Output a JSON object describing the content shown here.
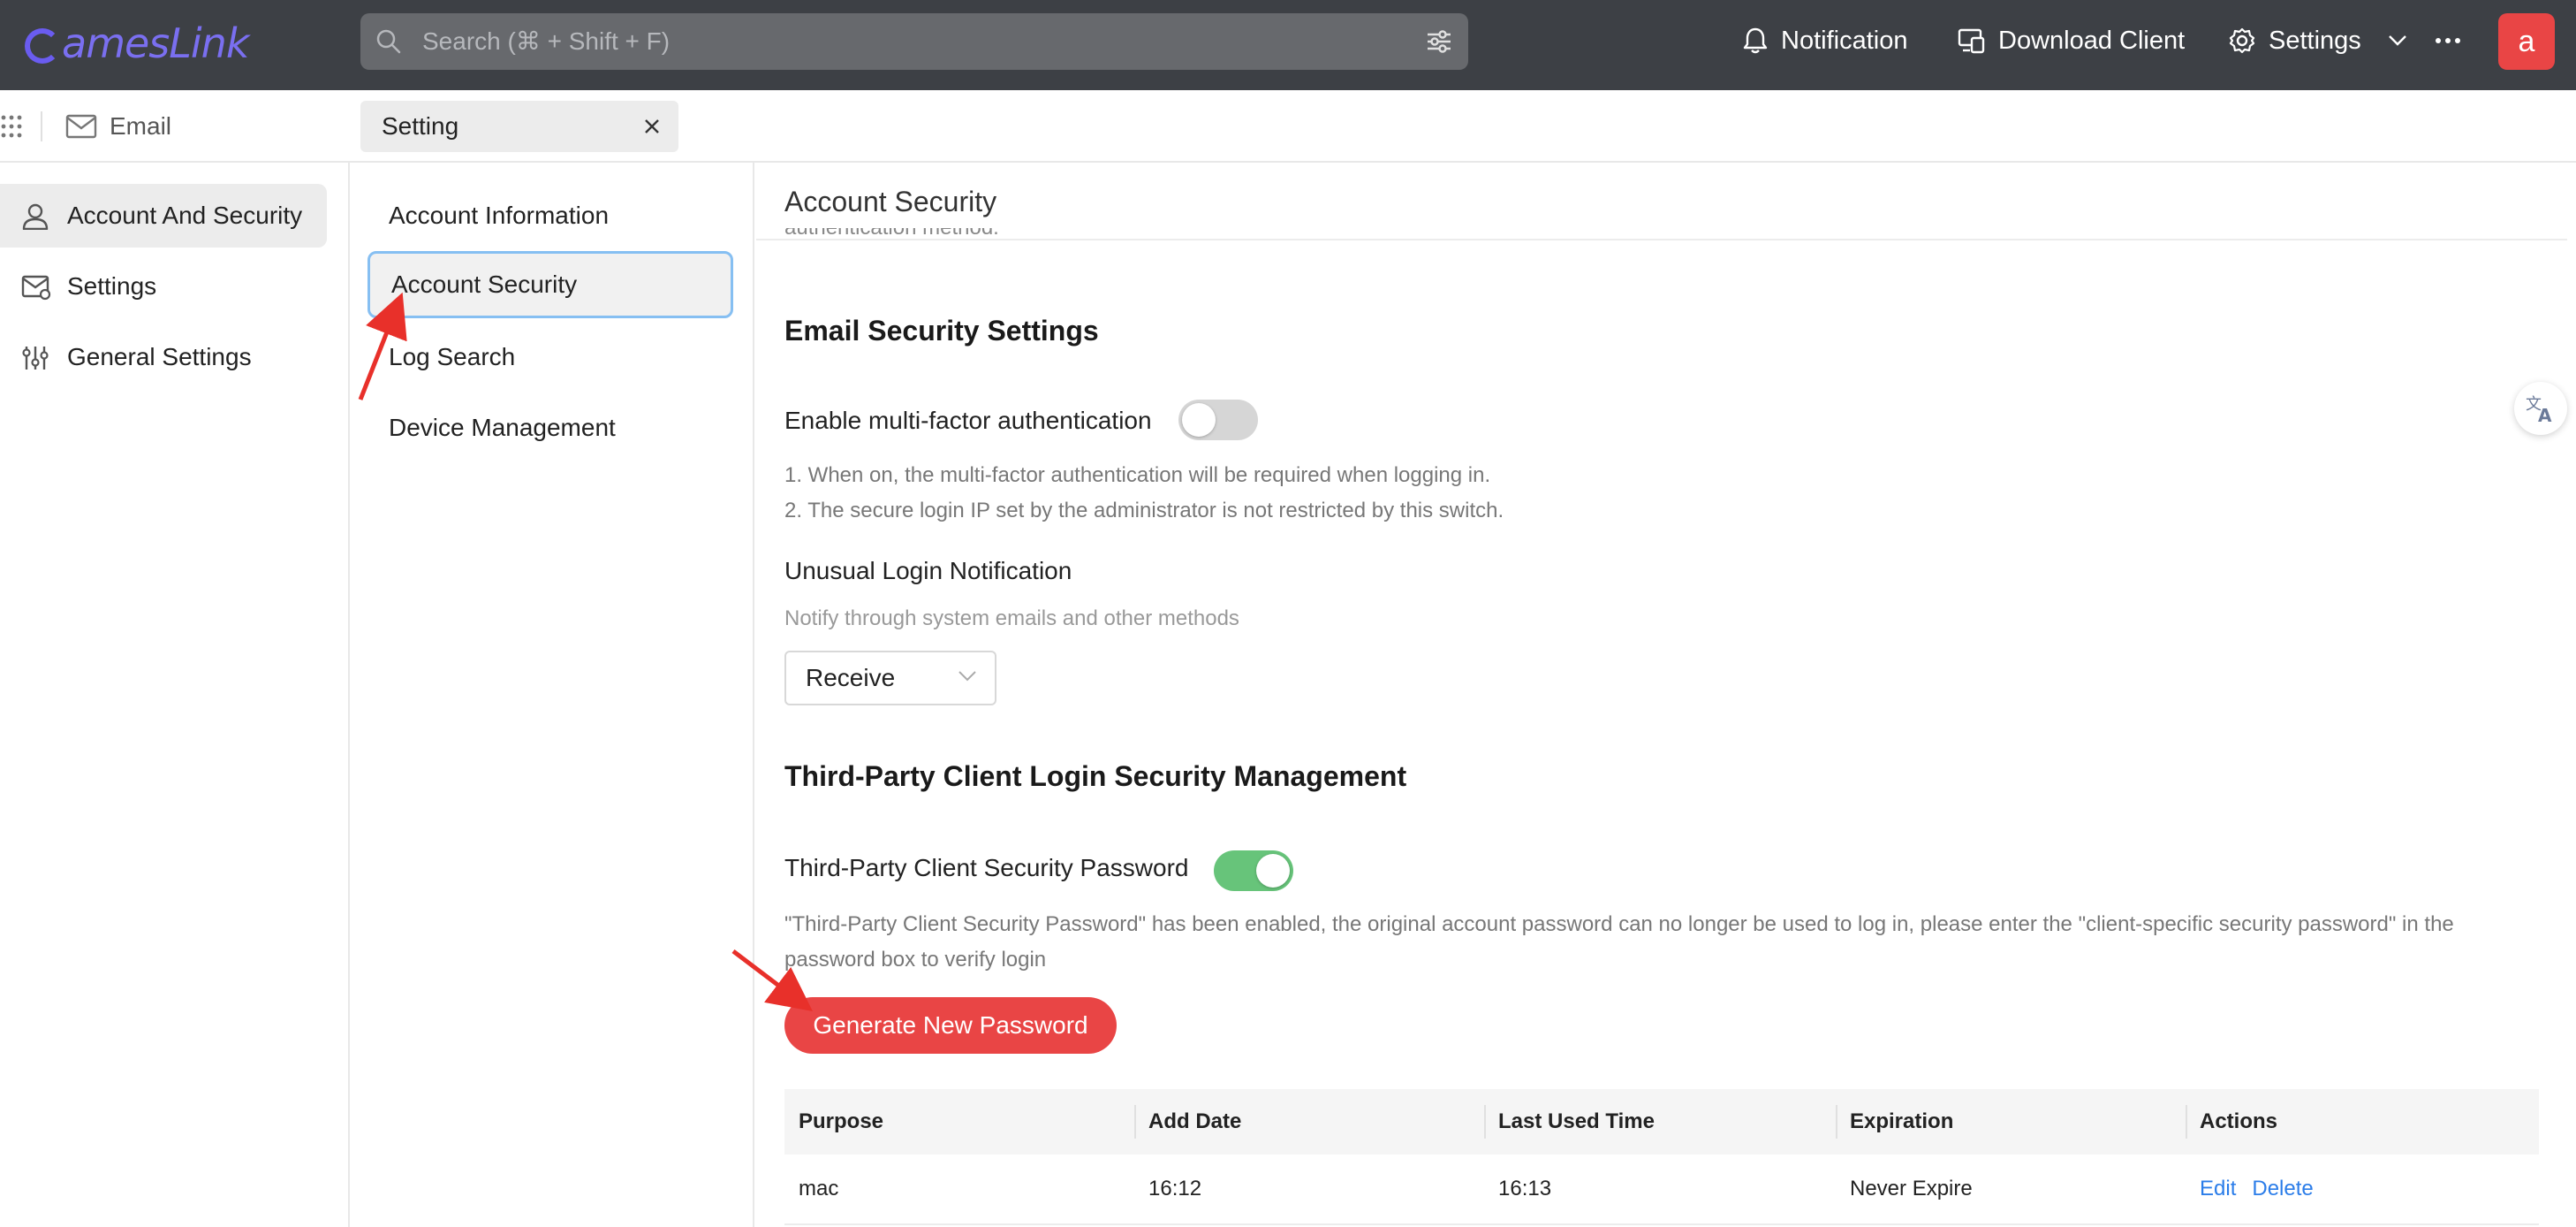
{
  "app": {
    "logo_text": "amesLink"
  },
  "topbar": {
    "search_placeholder": "Search (⌘ + Shift + F)",
    "notification_label": "Notification",
    "download_label": "Download Client",
    "settings_label": "Settings",
    "avatar_letter": "a"
  },
  "subbar": {
    "email_label": "Email",
    "tab_label": "Setting"
  },
  "sidebar": {
    "items": [
      {
        "label": "Account And Security",
        "icon": "user-icon",
        "active": true
      },
      {
        "label": "Settings",
        "icon": "mail-settings-icon",
        "active": false
      },
      {
        "label": "General Settings",
        "icon": "sliders-icon",
        "active": false
      }
    ]
  },
  "subnav": {
    "items": [
      {
        "label": "Account Information",
        "active": false
      },
      {
        "label": "Account Security",
        "active": true
      },
      {
        "label": "Log Search",
        "active": false
      },
      {
        "label": "Device Management",
        "active": false
      }
    ]
  },
  "main": {
    "title": "Account Security",
    "clipped_text": "authentication method.",
    "email_security": {
      "heading": "Email Security Settings",
      "mfa_label": "Enable multi-factor authentication",
      "mfa_enabled": false,
      "mfa_note_1": "1. When on, the multi-factor authentication will be required when logging in.",
      "mfa_note_2": "2. The secure login IP set by the administrator is not restricted by this switch.",
      "unusual_label": "Unusual Login Notification",
      "unusual_note": "Notify through system emails and other methods",
      "unusual_value": "Receive"
    },
    "third_party": {
      "heading": "Third-Party Client Login Security Management",
      "password_label": "Third-Party Client Security Password",
      "password_enabled": true,
      "note_line_1": "\"Third-Party Client Security Password\" has been enabled, the original account password can no longer be used to log in, please enter the \"client-specific security password\" in the",
      "note_line_2": "password box to verify login",
      "generate_label": "Generate New Password"
    },
    "table": {
      "headers": [
        "Purpose",
        "Add Date",
        "Last Used Time",
        "Expiration",
        "Actions"
      ],
      "rows": [
        {
          "purpose": "mac",
          "add_date": "16:12",
          "last_used": "16:13",
          "expiration": "Never Expire",
          "edit": "Edit",
          "delete": "Delete"
        }
      ]
    }
  },
  "colors": {
    "topbar": "#3d4045",
    "accent_red": "#e94545",
    "toggle_on": "#67c47a",
    "link_blue": "#2b7de9",
    "annotation_arrow": "#e8302a"
  }
}
